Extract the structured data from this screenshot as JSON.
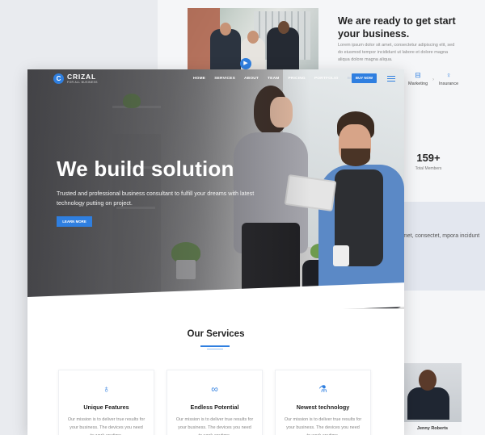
{
  "background_page": {
    "heading": "We are ready to get start your business.",
    "paragraph": "Lorem ipsum dolor sit amet, consectetur adipiscing elit, sed do eiusmod tempor incididunt ut labore et dolore magna aliqua dolore magna aliqua.",
    "features": [
      {
        "label": "Marketing",
        "icon": "briefcase-icon"
      },
      {
        "label": "Insurance",
        "icon": "lightbulb-icon"
      }
    ],
    "stat": {
      "value": "159+",
      "label": "Total Members"
    },
    "band_text": "amet, consectet, mpora incidunt",
    "person": {
      "name": "Jenny Roberts"
    }
  },
  "nav": {
    "brand": "CRIZAL",
    "tagline": "FOR ALL BUSINESS",
    "logo_letter": "C",
    "items": [
      "HOME",
      "SERVICES",
      "ABOUT",
      "TEAM",
      "PRICING",
      "PORTFOLIO",
      "BLOG"
    ],
    "cta": "BUY NOW"
  },
  "hero": {
    "title": "We build solution",
    "subtitle": "Trusted and professional business consultant to fulfill your dreams with latest technology putting on project.",
    "button": "LEARN MORE"
  },
  "services": {
    "title": "Our Services",
    "cards": [
      {
        "name": "Unique Features",
        "icon": "award-icon",
        "desc": "Our mission is to deliver true results for your business. The devices you need to work anytime."
      },
      {
        "name": "Endless Potential",
        "icon": "infinity-icon",
        "desc": "Our mission is to deliver true results for your business. The devices you need to work anytime."
      },
      {
        "name": "Newest technology",
        "icon": "flask-icon",
        "desc": "Our mission is to deliver true results for your business. The devices you need to work anytime."
      }
    ]
  },
  "colors": {
    "accent": "#2f7fe0",
    "text_dark": "#222222",
    "text_muted": "#888888"
  }
}
